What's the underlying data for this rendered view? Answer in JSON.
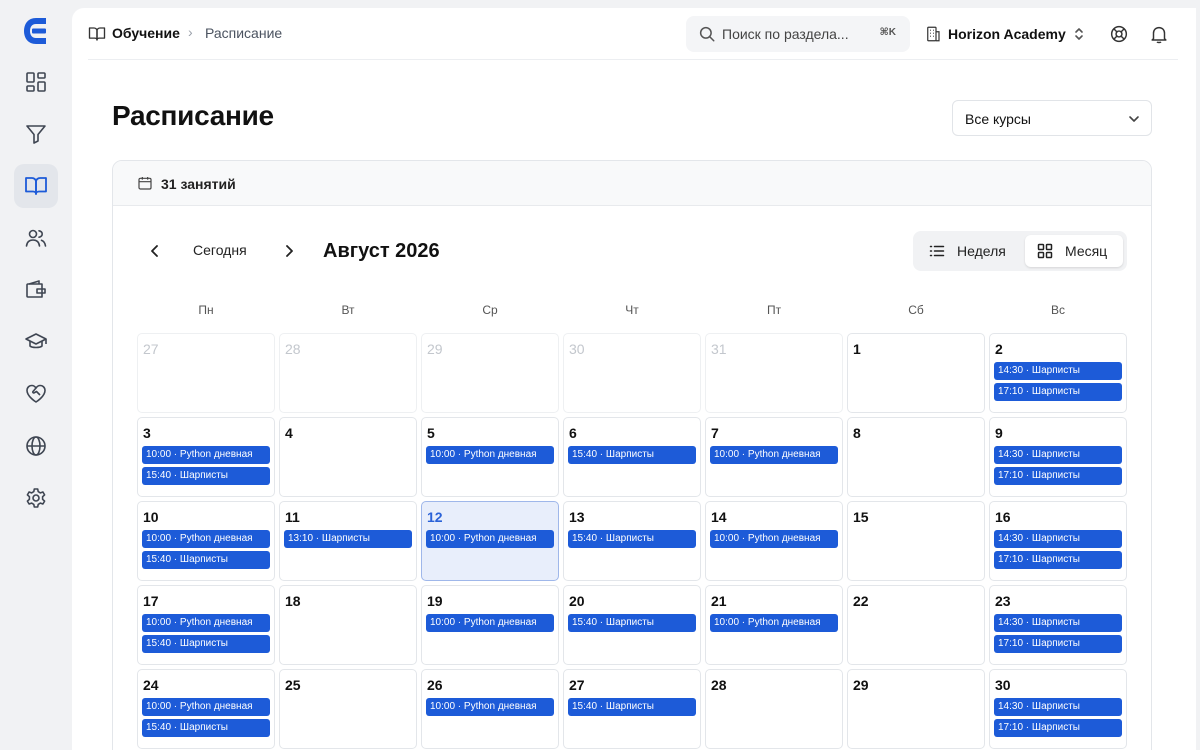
{
  "breadcrumb": {
    "root": "Обучение",
    "separator": "›",
    "current": "Расписание"
  },
  "search": {
    "placeholder": "Поиск по раздела...",
    "shortcut": "⌘K"
  },
  "org": {
    "name": "Horizon Academy"
  },
  "page": {
    "title": "Расписание"
  },
  "course_filter": {
    "value": "Все курсы"
  },
  "calendar": {
    "count_label": "31 занятий",
    "today_label": "Сегодня",
    "month_title": "Август 2026",
    "views": {
      "week": "Неделя",
      "month": "Месяц",
      "selected": "month"
    },
    "weekdays": [
      "Пн",
      "Вт",
      "Ср",
      "Чт",
      "Пт",
      "Сб",
      "Вс"
    ],
    "weeks": [
      [
        {
          "day": "27",
          "outside": true,
          "events": []
        },
        {
          "day": "28",
          "outside": true,
          "events": []
        },
        {
          "day": "29",
          "outside": true,
          "events": []
        },
        {
          "day": "30",
          "outside": true,
          "events": []
        },
        {
          "day": "31",
          "outside": true,
          "events": []
        },
        {
          "day": "1",
          "events": []
        },
        {
          "day": "2",
          "events": [
            "14:30 · Шарписты",
            "17:10 · Шарписты"
          ]
        }
      ],
      [
        {
          "day": "3",
          "events": [
            "10:00 · Python дневная",
            "15:40 · Шарписты"
          ]
        },
        {
          "day": "4",
          "events": []
        },
        {
          "day": "5",
          "events": [
            "10:00 · Python дневная"
          ]
        },
        {
          "day": "6",
          "events": [
            "15:40 · Шарписты"
          ]
        },
        {
          "day": "7",
          "events": [
            "10:00 · Python дневная"
          ]
        },
        {
          "day": "8",
          "events": []
        },
        {
          "day": "9",
          "events": [
            "14:30 · Шарписты",
            "17:10 · Шарписты"
          ]
        }
      ],
      [
        {
          "day": "10",
          "events": [
            "10:00 · Python дневная",
            "15:40 · Шарписты"
          ]
        },
        {
          "day": "11",
          "events": [
            "13:10 · Шарписты"
          ]
        },
        {
          "day": "12",
          "today": true,
          "events": [
            "10:00 · Python дневная"
          ]
        },
        {
          "day": "13",
          "events": [
            "15:40 · Шарписты"
          ]
        },
        {
          "day": "14",
          "events": [
            "10:00 · Python дневная"
          ]
        },
        {
          "day": "15",
          "events": []
        },
        {
          "day": "16",
          "events": [
            "14:30 · Шарписты",
            "17:10 · Шарписты"
          ]
        }
      ],
      [
        {
          "day": "17",
          "events": [
            "10:00 · Python дневная",
            "15:40 · Шарписты"
          ]
        },
        {
          "day": "18",
          "events": []
        },
        {
          "day": "19",
          "events": [
            "10:00 · Python дневная"
          ]
        },
        {
          "day": "20",
          "events": [
            "15:40 · Шарписты"
          ]
        },
        {
          "day": "21",
          "events": [
            "10:00 · Python дневная"
          ]
        },
        {
          "day": "22",
          "events": []
        },
        {
          "day": "23",
          "events": [
            "14:30 · Шарписты",
            "17:10 · Шарписты"
          ]
        }
      ],
      [
        {
          "day": "24",
          "events": [
            "10:00 · Python дневная",
            "15:40 · Шарписты"
          ]
        },
        {
          "day": "25",
          "events": []
        },
        {
          "day": "26",
          "events": [
            "10:00 · Python дневная"
          ]
        },
        {
          "day": "27",
          "events": [
            "15:40 · Шарписты"
          ]
        },
        {
          "day": "28",
          "events": []
        },
        {
          "day": "29",
          "events": []
        },
        {
          "day": "30",
          "events": [
            "14:30 · Шарписты",
            "17:10 · Шарписты"
          ]
        }
      ]
    ]
  },
  "sidebar": {
    "items": [
      {
        "icon": "dashboard-icon"
      },
      {
        "icon": "filter-icon"
      },
      {
        "icon": "book-icon",
        "active": true
      },
      {
        "icon": "users-icon"
      },
      {
        "icon": "wallet-icon"
      },
      {
        "icon": "graduation-cap-icon"
      },
      {
        "icon": "heart-handshake-icon"
      },
      {
        "icon": "globe-icon"
      },
      {
        "icon": "settings-icon"
      }
    ]
  },
  "colors": {
    "accent": "#1d5bd8",
    "today_bg": "#e8eefb",
    "sidebar_bg": "#f1f2f4"
  }
}
